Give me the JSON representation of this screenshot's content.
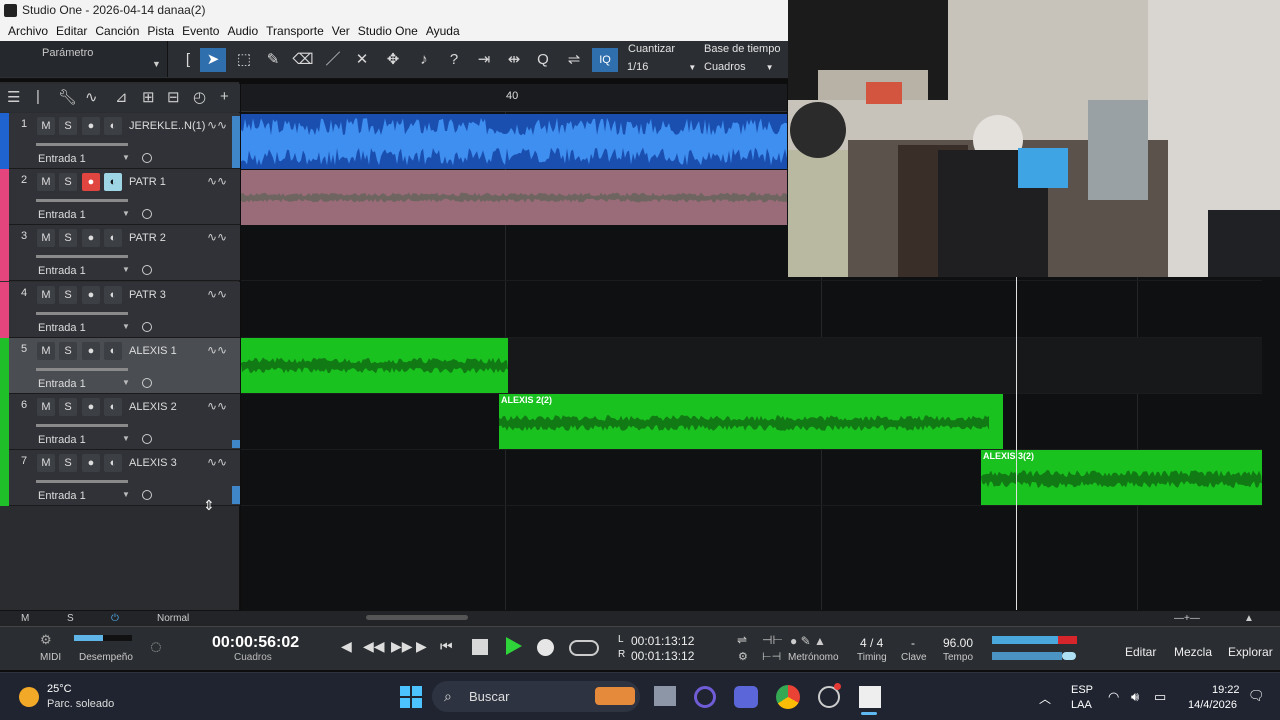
{
  "window": {
    "title": "Studio One - 2026-04-14 danaa(2)"
  },
  "menu": [
    "Archivo",
    "Editar",
    "Canción",
    "Pista",
    "Evento",
    "Audio",
    "Transporte",
    "Ver",
    "Studio One",
    "Ayuda"
  ],
  "toolbar": {
    "parameter_label": "Parámetro",
    "quantize_label": "Cuantizar",
    "quantize_value": "1/16",
    "timebase_label": "Base de tiempo",
    "timebase_value": "Cuadros",
    "quantize_btn": "IQ"
  },
  "ruler": {
    "bar_label": "40"
  },
  "tracks": [
    {
      "num": "1",
      "name": "JEREKLE..N(1)",
      "input": "Entrada 1",
      "color": "#1f63d0",
      "armed": false,
      "monitor": false
    },
    {
      "num": "2",
      "name": "PATR 1",
      "input": "Entrada 1",
      "color": "#e3457c",
      "armed": true,
      "monitor": true
    },
    {
      "num": "3",
      "name": "PATR 2",
      "input": "Entrada 1",
      "color": "#e3457c",
      "armed": false,
      "monitor": false
    },
    {
      "num": "4",
      "name": "PATR 3",
      "input": "Entrada 1",
      "color": "#e3457c",
      "armed": false,
      "monitor": false
    },
    {
      "num": "5",
      "name": "ALEXIS 1",
      "input": "Entrada 1",
      "color": "#1fbf2a",
      "armed": false,
      "monitor": false
    },
    {
      "num": "6",
      "name": "ALEXIS 2",
      "input": "Entrada 1",
      "color": "#1fbf2a",
      "armed": false,
      "monitor": false
    },
    {
      "num": "7",
      "name": "ALEXIS 3",
      "input": "Entrada 1",
      "color": "#1fbf2a",
      "armed": false,
      "monitor": false
    }
  ],
  "track_buttons": {
    "mute": "M",
    "solo": "S"
  },
  "clips": [
    {
      "name": "ALEXIS 2(2)"
    },
    {
      "name": "ALEXIS 3(2)"
    }
  ],
  "footer": {
    "m": "M",
    "s": "S",
    "mode": "Normal"
  },
  "transport": {
    "midi": "MIDI",
    "performance": "Desempeño",
    "time": "00:00:56:02",
    "time_format": "Cuadros",
    "loop_l_label": "L",
    "loop_l": "00:01:13:12",
    "loop_r_label": "R",
    "loop_r": "00:01:13:12",
    "metronome": "Metrónomo",
    "timing_value": "4 / 4",
    "timing": "Timing",
    "key_value": "-",
    "key": "Clave",
    "tempo_value": "96.00",
    "tempo": "Tempo",
    "views": [
      "Editar",
      "Mezcla",
      "Explorar"
    ]
  },
  "taskbar": {
    "temp": "25°C",
    "weather": "Parc. soleado",
    "search": "Buscar",
    "lang1": "ESP",
    "lang2": "LAA",
    "time": "19:22",
    "date": "14/4/2026"
  }
}
